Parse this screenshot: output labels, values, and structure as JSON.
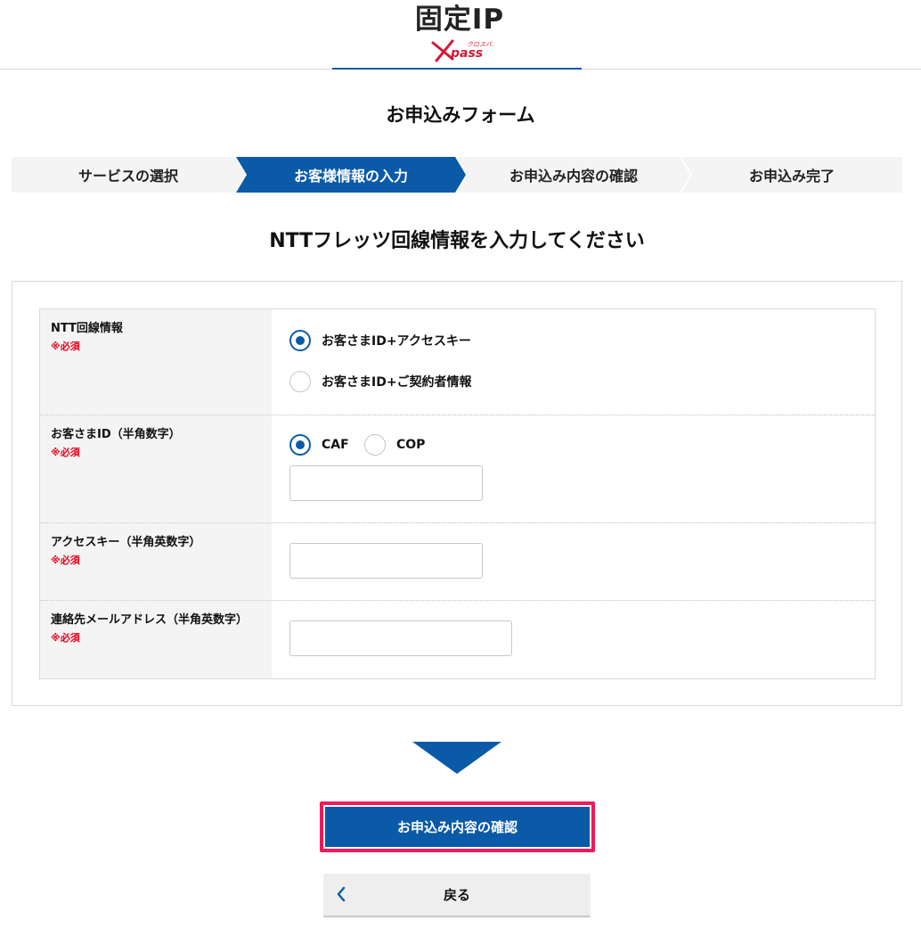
{
  "header": {
    "logo_main": "固定IP",
    "logo_sub_kana": "クロスパス",
    "logo_sub_brand": "Xpass"
  },
  "page_title": "お申込みフォーム",
  "steps": [
    {
      "label": "サービスの選択",
      "active": false
    },
    {
      "label": "お客様情報の入力",
      "active": true
    },
    {
      "label": "お申込み内容の確認",
      "active": false
    },
    {
      "label": "お申込み完了",
      "active": false
    }
  ],
  "section_title": "NTTフレッツ回線情報を入力してください",
  "form": {
    "line_info": {
      "label": "NTT回線情報",
      "required": "※必須",
      "options": [
        {
          "label": "お客さまID+アクセスキー",
          "selected": true
        },
        {
          "label": "お客さまID+ご契約者情報",
          "selected": false
        }
      ]
    },
    "customer_id": {
      "label": "お客さまID（半角数字）",
      "required": "※必須",
      "options": [
        {
          "label": "CAF",
          "selected": true
        },
        {
          "label": "COP",
          "selected": false
        }
      ],
      "value": ""
    },
    "access_key": {
      "label": "アクセスキー（半角英数字）",
      "required": "※必須",
      "value": ""
    },
    "email": {
      "label": "連絡先メールアドレス（半角英数字）",
      "required": "※必須",
      "value": ""
    }
  },
  "buttons": {
    "confirm": "お申込み内容の確認",
    "back": "戻る"
  },
  "colors": {
    "brand_blue": "#0a5aa8",
    "required_red": "#e4001b",
    "highlight_pink": "#f0195a"
  }
}
